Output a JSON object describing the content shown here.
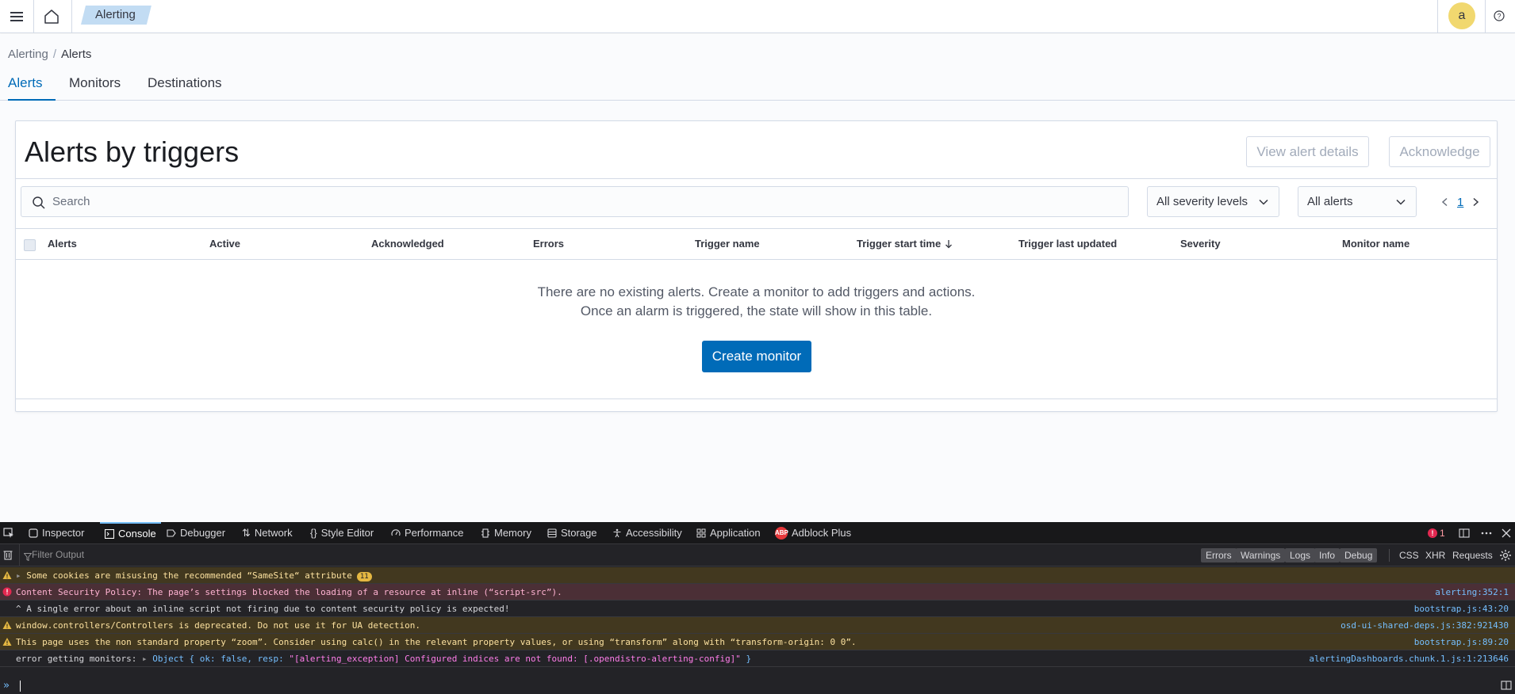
{
  "header": {
    "app_breadcrumb": "Alerting",
    "avatar_initial": "a",
    "icons": [
      "menu-icon",
      "home-icon",
      "help-icon"
    ]
  },
  "breadcrumbs": {
    "parent": "Alerting",
    "separator": "/",
    "current": "Alerts"
  },
  "tabs": [
    {
      "label": "Alerts",
      "selected": true
    },
    {
      "label": "Monitors",
      "selected": false
    },
    {
      "label": "Destinations",
      "selected": false
    }
  ],
  "panel": {
    "title": "Alerts by triggers",
    "view_details_label": "View alert details",
    "acknowledge_label": "Acknowledge",
    "search_placeholder": "Search",
    "severity_filter": "All severity levels",
    "state_filter": "All alerts",
    "current_page": "1",
    "columns": [
      "Alerts",
      "Active",
      "Acknowledged",
      "Errors",
      "Trigger name",
      "Trigger start time",
      "Trigger last updated",
      "Severity",
      "Monitor name"
    ],
    "sorted_column_icon": "arrow-down-icon",
    "empty_line1": "There are no existing alerts. Create a monitor to add triggers and actions.",
    "empty_line2": "Once an alarm is triggered, the state will show in this table.",
    "create_monitor_label": "Create monitor"
  },
  "devtools": {
    "tabs": [
      "Inspector",
      "Console",
      "Debugger",
      "Network",
      "Style Editor",
      "Performance",
      "Memory",
      "Storage",
      "Accessibility",
      "Application",
      "Adblock Plus"
    ],
    "selected_tab": "Console",
    "abp_badge": "ABP",
    "error_count": "1",
    "filter_placeholder": "Filter Output",
    "filter_buttons": [
      "Errors",
      "Warnings",
      "Logs",
      "Info",
      "Debug"
    ],
    "extra_filters": [
      "CSS",
      "XHR",
      "Requests"
    ],
    "messages": [
      {
        "level": "warn",
        "text": "Some cookies are misusing the recommended “SameSite“ attribute",
        "count": "11",
        "source": ""
      },
      {
        "level": "err",
        "text": "Content Security Policy: The page’s settings blocked the loading of a resource at inline (“script-src”).",
        "source": "alerting:352:1"
      },
      {
        "level": "plain",
        "text": "^ A single error about an inline script not firing due to content security policy is expected!",
        "source": "bootstrap.js:43:20"
      },
      {
        "level": "warn",
        "text": "window.controllers/Controllers is deprecated. Do not use it for UA detection.",
        "source": "osd-ui-shared-deps.js:382:921430"
      },
      {
        "level": "warn",
        "text": "This page uses the non standard property “zoom”. Consider using calc() in the relevant property values, or using “transform” along with “transform-origin: 0 0”.",
        "source": "bootstrap.js:89:20"
      },
      {
        "level": "plain",
        "text_prefix": "error getting monitors: ",
        "object_label": "Object { ok: false, resp: ",
        "object_string": "\"[alerting_exception] Configured indices are not found: [.opendistro-alerting-config]\"",
        "object_close": " }",
        "source": "alertingDashboards.chunk.1.js:1:213646"
      }
    ]
  }
}
